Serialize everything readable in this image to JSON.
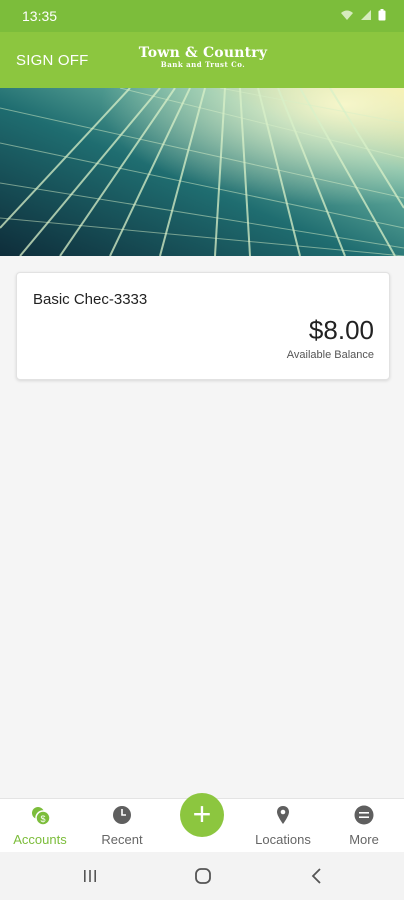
{
  "status_bar": {
    "time": "13:35"
  },
  "header": {
    "sign_off_label": "SIGN OFF",
    "logo_main": "Town & Country",
    "logo_sub": "Bank and Trust Co."
  },
  "account": {
    "name": "Basic Chec-3333",
    "balance": "$8.00",
    "balance_caption": "Available Balance"
  },
  "bottom_nav": {
    "items": [
      {
        "label": "Accounts",
        "icon": "accounts-icon",
        "active": true
      },
      {
        "label": "Recent",
        "icon": "clock-icon",
        "active": false
      },
      {
        "label": "Locations",
        "icon": "location-pin-icon",
        "active": false
      },
      {
        "label": "More",
        "icon": "more-icon",
        "active": false
      }
    ],
    "add_label": "+"
  },
  "colors": {
    "brand_green": "#8cc63f",
    "status_green": "#7cbd3b",
    "active_label": "#7cbd3b"
  }
}
